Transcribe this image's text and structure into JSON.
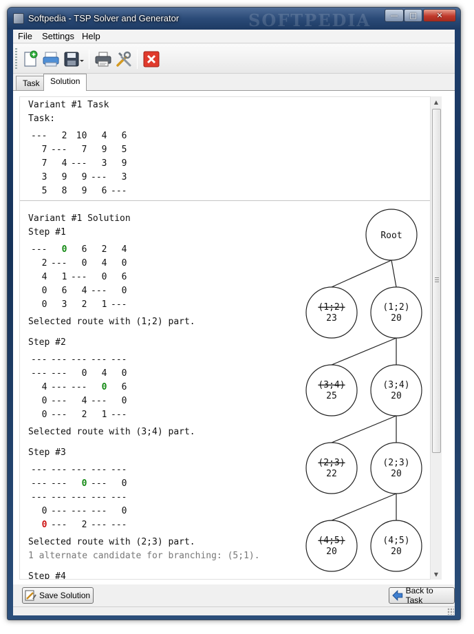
{
  "window": {
    "title": "Softpedia - TSP Solver and Generator",
    "watermark": "SOFTPEDIA",
    "controls": {
      "minimize": "—",
      "maximize": "□",
      "close": "✕"
    }
  },
  "menu": [
    "File",
    "Settings",
    "Help"
  ],
  "toolbar": [
    "new-icon",
    "open-icon",
    "save-icon",
    "print-icon",
    "tools-icon",
    "exit-icon"
  ],
  "tabs": [
    {
      "label": "Task",
      "active": false
    },
    {
      "label": "Solution",
      "active": true
    }
  ],
  "task": {
    "heading": "Variant #1 Task",
    "subheading": "Task:",
    "matrix": [
      [
        "---",
        "2",
        "10",
        "4",
        "6"
      ],
      [
        "7",
        "---",
        "7",
        "9",
        "5"
      ],
      [
        "7",
        "4",
        "---",
        "3",
        "9"
      ],
      [
        "3",
        "9",
        "9",
        "---",
        "3"
      ],
      [
        "5",
        "8",
        "9",
        "6",
        "---"
      ]
    ]
  },
  "solution": {
    "heading": "Variant #1 Solution",
    "steps": [
      {
        "title": "Step #1",
        "matrix": [
          [
            "---",
            "0",
            "6",
            "2",
            "4"
          ],
          [
            "2",
            "---",
            "0",
            "4",
            "0"
          ],
          [
            "4",
            "1",
            "---",
            "0",
            "6"
          ],
          [
            "0",
            "6",
            "4",
            "---",
            "0"
          ],
          [
            "0",
            "3",
            "2",
            "1",
            "---"
          ]
        ],
        "highlights": [
          {
            "row": 0,
            "col": 1,
            "color": "green"
          }
        ],
        "result": "Selected route with (1;2) part."
      },
      {
        "title": "Step #2",
        "matrix": [
          [
            "---",
            "---",
            "---",
            "---",
            "---"
          ],
          [
            "---",
            "---",
            "0",
            "4",
            "0"
          ],
          [
            "4",
            "---",
            "---",
            "0",
            "6"
          ],
          [
            "0",
            "---",
            "4",
            "---",
            "0"
          ],
          [
            "0",
            "---",
            "2",
            "1",
            "---"
          ]
        ],
        "highlights": [
          {
            "row": 2,
            "col": 3,
            "color": "green"
          }
        ],
        "result": "Selected route with (3;4) part."
      },
      {
        "title": "Step #3",
        "matrix": [
          [
            "---",
            "---",
            "---",
            "---",
            "---"
          ],
          [
            "---",
            "---",
            "0",
            "---",
            "0"
          ],
          [
            "---",
            "---",
            "---",
            "---",
            "---"
          ],
          [
            "0",
            "---",
            "---",
            "---",
            "0"
          ],
          [
            "0",
            "---",
            "2",
            "---",
            "---"
          ]
        ],
        "highlights": [
          {
            "row": 1,
            "col": 2,
            "color": "green"
          },
          {
            "row": 4,
            "col": 0,
            "color": "red"
          }
        ],
        "result": "Selected route with (2;3) part.",
        "note": "1 alternate candidate for branching: (5;1)."
      },
      {
        "title": "Step #4"
      }
    ]
  },
  "tree": {
    "root": "Root",
    "levels": [
      {
        "excluded": {
          "label": "(1;2)",
          "cost": "23"
        },
        "included": {
          "label": "(1;2)",
          "cost": "20"
        }
      },
      {
        "excluded": {
          "label": "(3;4)",
          "cost": "25"
        },
        "included": {
          "label": "(3;4)",
          "cost": "20"
        }
      },
      {
        "excluded": {
          "label": "(2;3)",
          "cost": "22"
        },
        "included": {
          "label": "(2;3)",
          "cost": "20"
        }
      },
      {
        "excluded": {
          "label": "(4;5)",
          "cost": "20"
        },
        "included": {
          "label": "(4;5)",
          "cost": "20"
        }
      }
    ]
  },
  "buttons": {
    "save": "Save Solution",
    "back": "Back to Task"
  },
  "colors": {
    "highlight_green": "#118811",
    "highlight_red": "#cc1111",
    "close_red": "#c0392b"
  }
}
